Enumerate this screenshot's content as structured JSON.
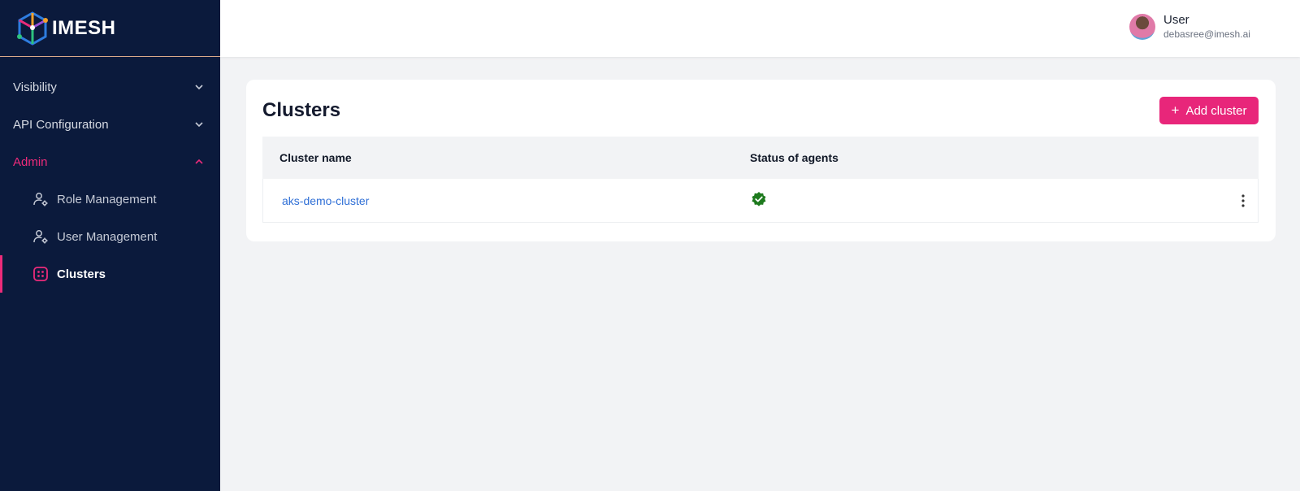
{
  "brand": {
    "name": "IMESH"
  },
  "sidebar": {
    "groups": [
      {
        "label": "Visibility",
        "expanded": false
      },
      {
        "label": "API Configuration",
        "expanded": false
      },
      {
        "label": "Admin",
        "expanded": true
      }
    ],
    "admin_items": [
      {
        "label": "Role Management",
        "icon": "user-gear-icon"
      },
      {
        "label": "User Management",
        "icon": "user-gear-icon"
      },
      {
        "label": "Clusters",
        "icon": "clusters-icon",
        "active": true
      }
    ]
  },
  "header": {
    "user": {
      "name": "User",
      "email": "debasree@imesh.ai"
    }
  },
  "main": {
    "title": "Clusters",
    "add_button_label": "Add cluster",
    "table": {
      "columns": [
        "Cluster name",
        "Status of agents"
      ],
      "rows": [
        {
          "name": "aks-demo-cluster",
          "status": "verified"
        }
      ]
    }
  },
  "colors": {
    "sidebar_bg": "#0b1a3c",
    "accent": "#e8267a",
    "link": "#2f6fd6",
    "status_ok": "#1e7a1e"
  }
}
